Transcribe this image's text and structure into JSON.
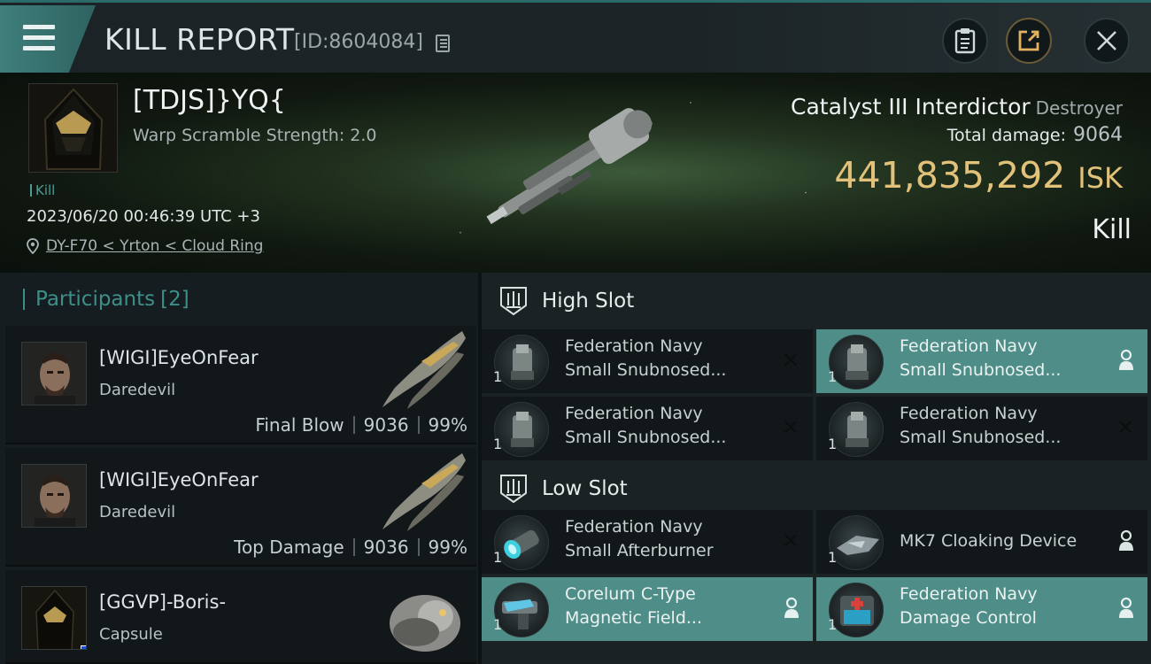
{
  "header": {
    "title": "KILL REPORT",
    "report_id": "[ID:8604084]",
    "icons": [
      "menu-icon",
      "copy-icon",
      "clipboard-icon",
      "share-icon",
      "close-icon"
    ]
  },
  "victim": {
    "name": "[TDJS]}YQ{",
    "warp_scramble": "Warp Scramble Strength: 2.0",
    "kill_tag": "Kill",
    "time": "2023/06/20 00:46:39 UTC +3",
    "location": "DY-F70 < Yrton < Cloud Ring",
    "ship_name": "Catalyst III Interdictor",
    "ship_class": "Destroyer",
    "total_damage_label": "Total damage:",
    "total_damage": "9064",
    "isk_value": "441,835,292",
    "isk_unit": "ISK",
    "result": "Kill"
  },
  "participants": {
    "title": "Participants",
    "count": "[2]",
    "items": [
      {
        "name": "[WIGI]EyeOnFear",
        "ship": "Daredevil",
        "role": "Final Blow",
        "damage": "9036",
        "percent": "99%"
      },
      {
        "name": "[WIGI]EyeOnFear",
        "ship": "Daredevil",
        "role": "Top Damage",
        "damage": "9036",
        "percent": "99%"
      },
      {
        "name": "[GGVP]-Boris-",
        "ship": "Capsule"
      }
    ]
  },
  "fitting": {
    "high_slot": {
      "label": "High Slot",
      "modules": [
        {
          "line1": "Federation Navy",
          "line2": "Small Snubnosed...",
          "qty": "1",
          "status": "destroyed"
        },
        {
          "line1": "Federation Navy",
          "line2": "Small Snubnosed...",
          "qty": "1",
          "status": "dropped"
        },
        {
          "line1": "Federation Navy",
          "line2": "Small Snubnosed...",
          "qty": "1",
          "status": "destroyed"
        },
        {
          "line1": "Federation Navy",
          "line2": "Small Snubnosed...",
          "qty": "1",
          "status": "destroyed"
        }
      ]
    },
    "low_slot": {
      "label": "Low Slot",
      "modules": [
        {
          "line1": "Federation Navy",
          "line2": "Small Afterburner",
          "qty": "1",
          "status": "destroyed"
        },
        {
          "line1": "MK7 Cloaking Device",
          "qty": "1",
          "status": "dropped"
        },
        {
          "line1": "Corelum C-Type",
          "line2": "Magnetic Field...",
          "qty": "1",
          "status": "dropped"
        },
        {
          "line1": "Federation Navy",
          "line2": "Damage Control",
          "qty": "1",
          "status": "dropped"
        }
      ]
    }
  },
  "colors": {
    "accent": "#3d8f8a",
    "isk": "#e2c27a",
    "dropped": "#4f8e88"
  }
}
